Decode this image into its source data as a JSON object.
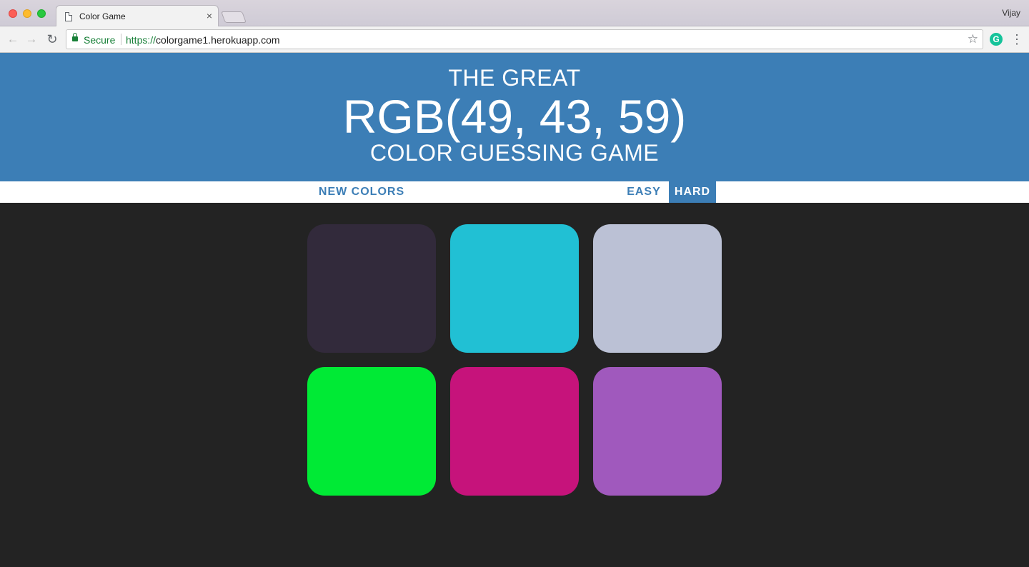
{
  "browser": {
    "tab_title": "Color Game",
    "tab_close": "×",
    "profile_name": "Vijay",
    "secure_label": "Secure",
    "url_scheme": "https://",
    "url_host": "colorgame1.herokuapp.com",
    "icons": [
      "back-icon",
      "forward-icon",
      "reload-icon",
      "lock-icon",
      "star-icon",
      "grammarly-icon",
      "menu-icon"
    ]
  },
  "header": {
    "line1": "THE GREAT",
    "target_color": "RGB(49, 43, 59)",
    "line3": "COLOR GUESSING GAME",
    "background": "#3c7eb6"
  },
  "controls": {
    "new_colors": "NEW COLORS",
    "easy": "EASY",
    "hard": "HARD",
    "selected_mode": "HARD"
  },
  "squares": [
    {
      "color": "#322a3b"
    },
    {
      "color": "#21c0d4"
    },
    {
      "color": "#bbc1d5"
    },
    {
      "color": "#00ea35"
    },
    {
      "color": "#c6137b"
    },
    {
      "color": "#a059bd"
    }
  ],
  "colors": {
    "page_background": "#232323",
    "accent": "#3c7eb6"
  }
}
